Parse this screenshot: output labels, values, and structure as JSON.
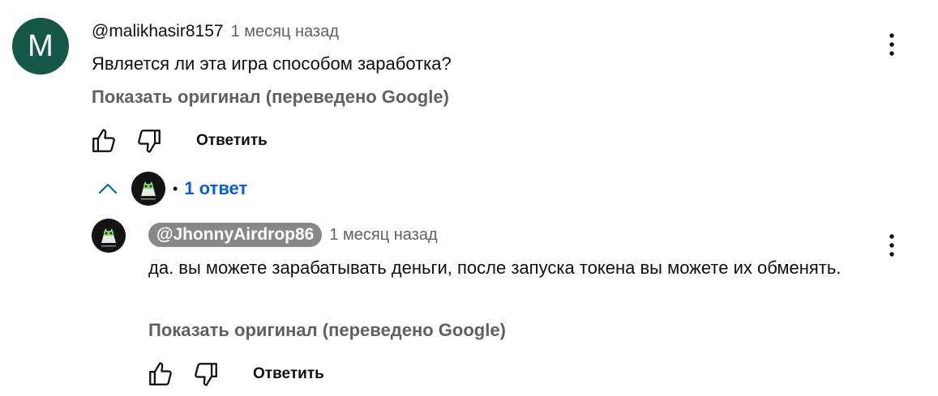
{
  "comment": {
    "avatar_letter": "M",
    "author": "@malikhasir8157",
    "timestamp": "1 месяц назад",
    "text": "Является ли эта игра способом заработка?",
    "translate_link": "Показать оригинал (переведено Google)",
    "reply_label": "Ответить",
    "avatar_color": "#15584a"
  },
  "replies_toggle": {
    "bullet": "•",
    "count_label": "1 ответ",
    "link_color": "#065fd4"
  },
  "reply": {
    "author": "@JhonnyAirdrop86",
    "timestamp": "1 месяц назад",
    "text": "да. вы можете зарабатывать деньги, после запуска токена вы можете их обменять.",
    "translate_link": "Показать оригинал (переведено Google)",
    "reply_label": "Ответить"
  },
  "icons": {
    "like": "thumb-up-icon",
    "dislike": "thumb-down-icon",
    "menu": "more-vert-icon",
    "collapse": "chevron-up-icon"
  }
}
